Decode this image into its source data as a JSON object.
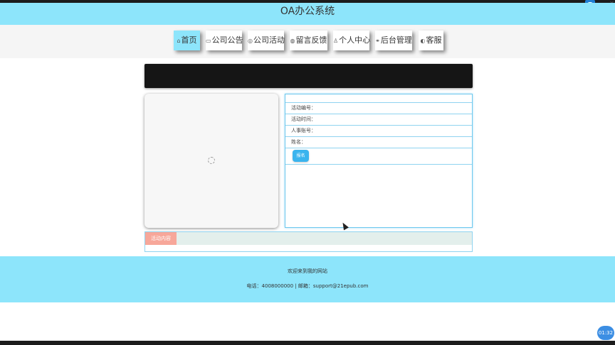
{
  "site": {
    "title": "OA办公系统"
  },
  "nav": {
    "items": [
      {
        "label": "首页",
        "icon": "home-icon",
        "glyph": "⌂"
      },
      {
        "label": "公司公告",
        "icon": "notice-icon",
        "glyph": "▭"
      },
      {
        "label": "公司活动",
        "icon": "activity-icon",
        "glyph": "◎"
      },
      {
        "label": "留言反馈",
        "icon": "feedback-icon",
        "glyph": "◍"
      },
      {
        "label": "个人中心",
        "icon": "user-icon",
        "glyph": "♙"
      },
      {
        "label": "后台管理",
        "icon": "link-icon",
        "glyph": "⚭"
      },
      {
        "label": "客服",
        "icon": "support-icon",
        "glyph": "◐"
      }
    ],
    "active_index": 0
  },
  "detail": {
    "fields": [
      {
        "label": "活动编号：",
        "value": ""
      },
      {
        "label": "活动时间：",
        "value": ""
      },
      {
        "label": "人事账号：",
        "value": ""
      },
      {
        "label": "姓名：",
        "value": ""
      }
    ],
    "signup_button": "报名"
  },
  "content": {
    "tab_label": "活动内容"
  },
  "footer": {
    "welcome": "欢迎来到我的网站",
    "contact": "电话：4008000000 | 邮箱：support@21epub.com"
  },
  "system": {
    "clock": "01:32"
  },
  "colors": {
    "accent": "#8de5fb",
    "button": "#3ab4ee",
    "tab": "#f7a79a"
  }
}
